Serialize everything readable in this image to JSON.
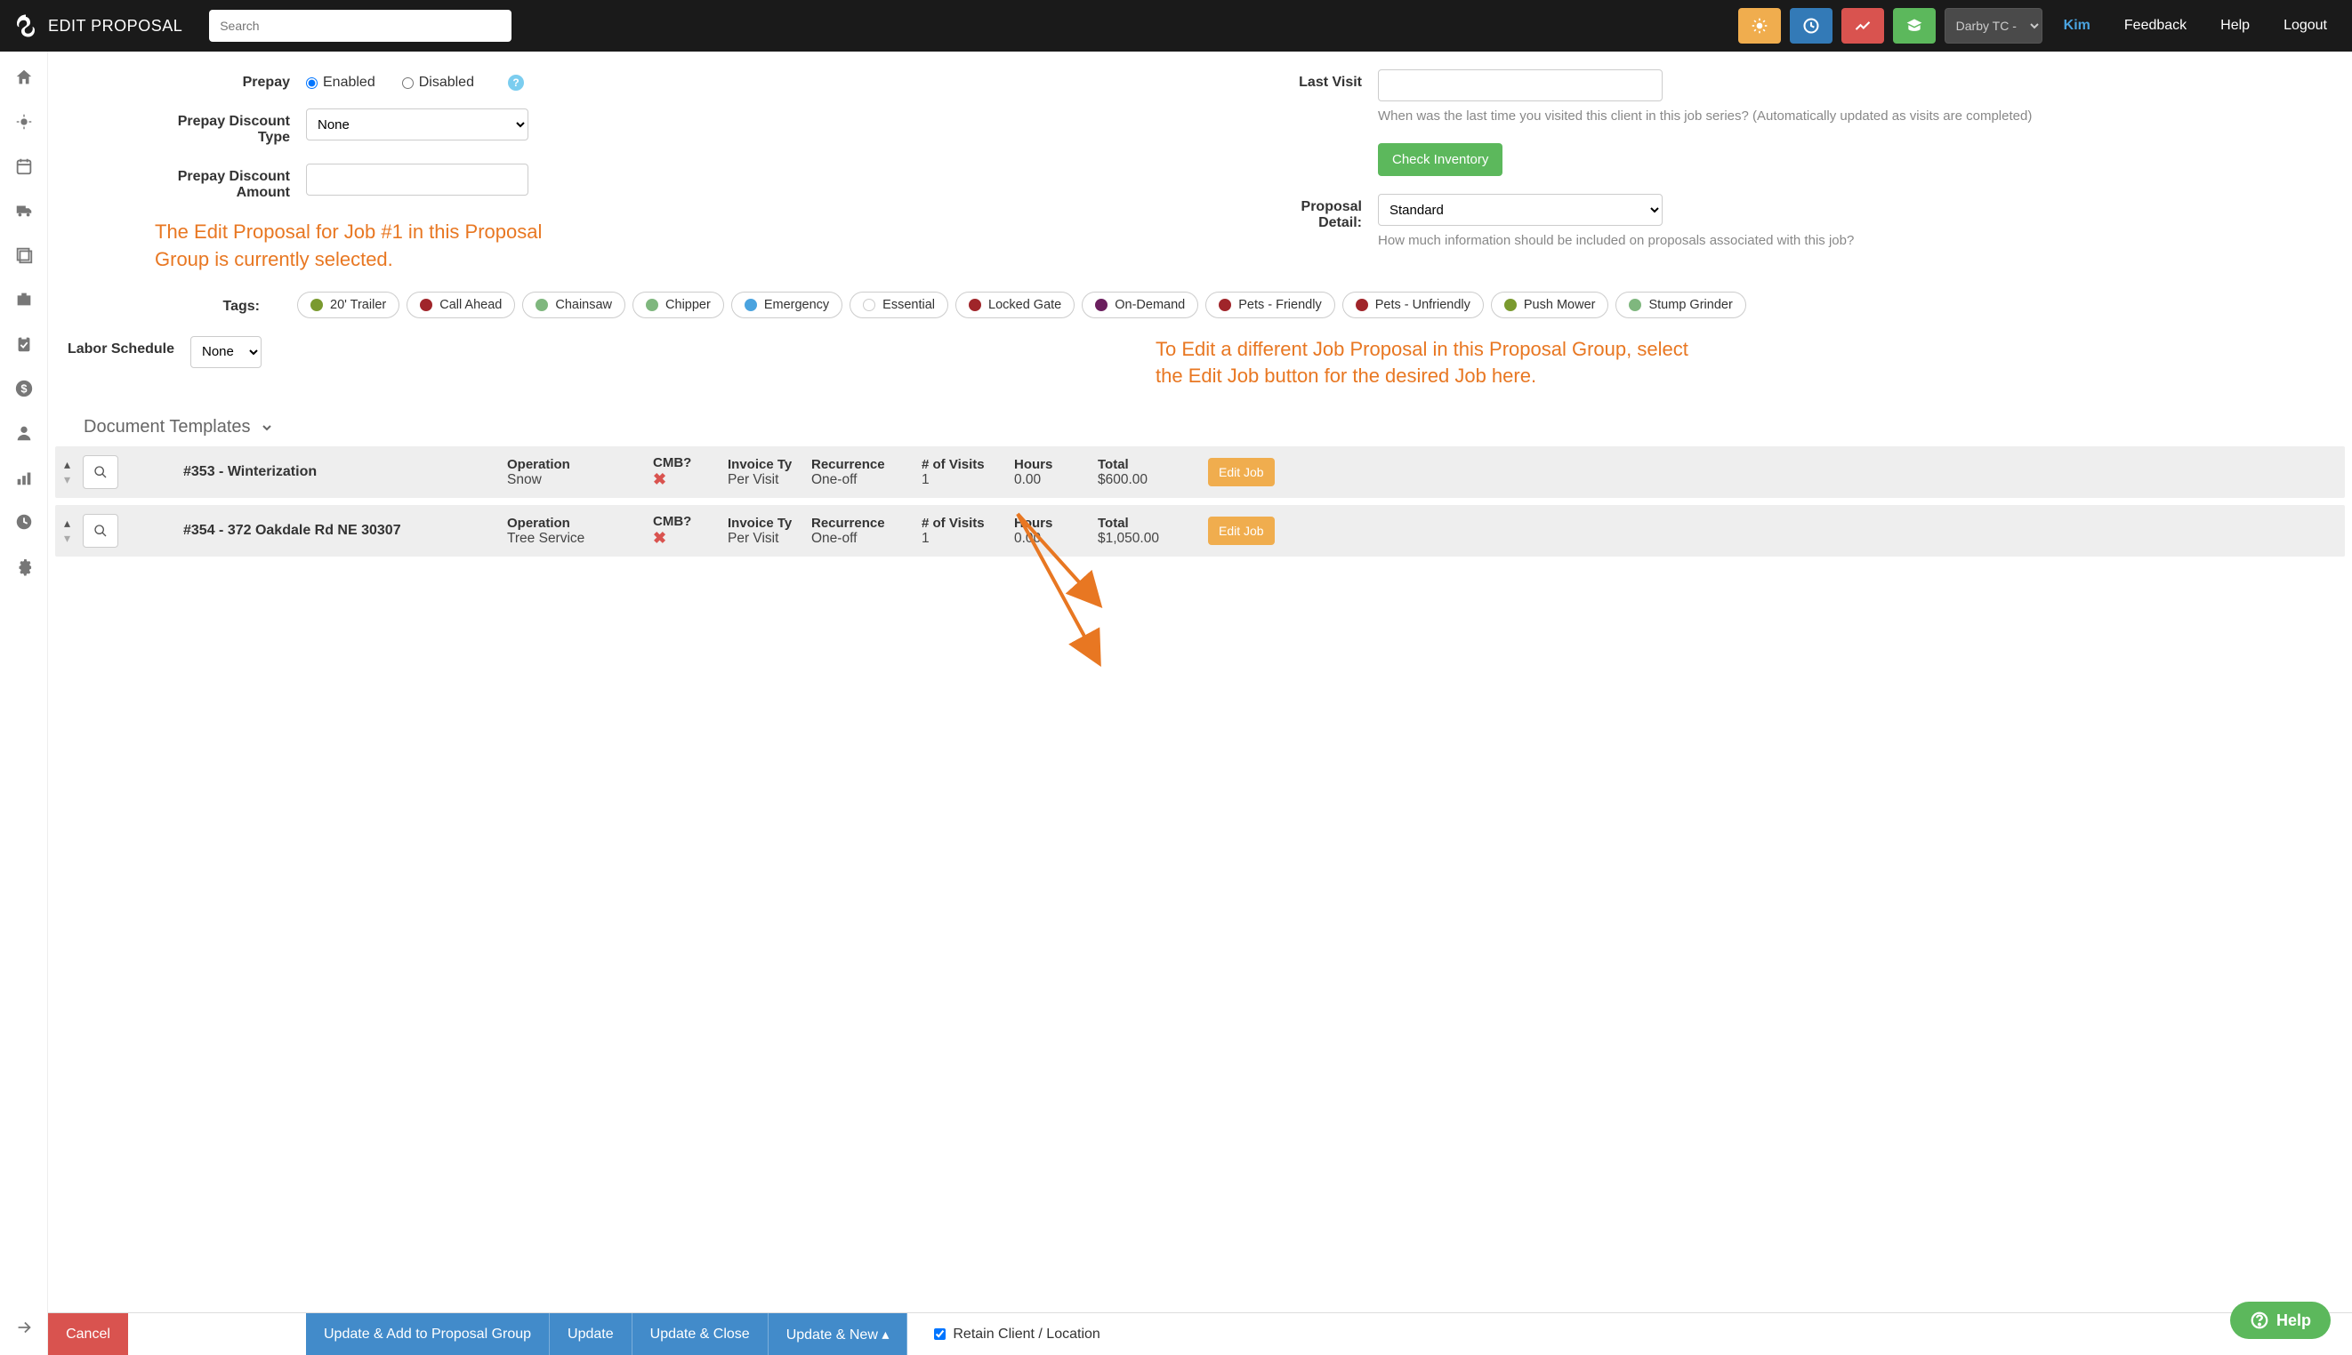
{
  "header": {
    "title": "EDIT PROPOSAL",
    "search_placeholder": "Search",
    "org_selector": "Darby TC - Ki",
    "user": "Kim",
    "links": {
      "feedback": "Feedback",
      "help": "Help",
      "logout": "Logout"
    }
  },
  "form": {
    "prepay": {
      "label": "Prepay",
      "enabled": "Enabled",
      "disabled": "Disabled",
      "selected": "enabled"
    },
    "discount_type": {
      "label": "Prepay Discount Type",
      "value": "None"
    },
    "discount_amount": {
      "label": "Prepay Discount Amount",
      "value": ""
    },
    "last_visit": {
      "label": "Last Visit",
      "value": "",
      "help": "When was the last time you visited this client in this job series? (Automatically updated as visits are completed)"
    },
    "check_inventory": "Check Inventory",
    "proposal_detail": {
      "label": "Proposal Detail:",
      "value": "Standard",
      "help": "How much information should be included on proposals associated with this job?"
    },
    "labor_schedule": {
      "label": "Labor Schedule",
      "value": "None"
    }
  },
  "callouts": {
    "left": "The Edit Proposal for Job #1 in this Proposal Group is currently selected.",
    "right": "To Edit a different Job Proposal in this Proposal Group, select the Edit Job button for the desired Job here."
  },
  "tags_label": "Tags:",
  "tags": [
    {
      "label": "20' Trailer",
      "color": "#7a9a2f"
    },
    {
      "label": "Call Ahead",
      "color": "#a0252a"
    },
    {
      "label": "Chainsaw",
      "color": "#7fb77e"
    },
    {
      "label": "Chipper",
      "color": "#7fb77e"
    },
    {
      "label": "Emergency",
      "color": "#4aa3df"
    },
    {
      "label": "Essential",
      "color": "#ffffff"
    },
    {
      "label": "Locked Gate",
      "color": "#a0252a"
    },
    {
      "label": "On-Demand",
      "color": "#6b1f5e"
    },
    {
      "label": "Pets - Friendly",
      "color": "#a0252a"
    },
    {
      "label": "Pets - Unfriendly",
      "color": "#a0252a"
    },
    {
      "label": "Push Mower",
      "color": "#7a9a2f"
    },
    {
      "label": "Stump Grinder",
      "color": "#7fb77e"
    }
  ],
  "doc_templates": "Document Templates",
  "job_headers": {
    "operation": "Operation",
    "cmb": "CMB?",
    "invoice": "Invoice Ty",
    "recurrence": "Recurrence",
    "visits": "# of Visits",
    "hours": "Hours",
    "total": "Total",
    "edit": "Edit Job"
  },
  "jobs": [
    {
      "title": "#353 - Winterization",
      "operation": "Snow",
      "invoice": "Per Visit",
      "recurrence": "One-off",
      "visits": "1",
      "hours": "0.00",
      "total": "$600.00"
    },
    {
      "title": "#354 - 372 Oakdale Rd NE 30307",
      "operation": "Tree Service",
      "invoice": "Per Visit",
      "recurrence": "One-off",
      "visits": "1",
      "hours": "0.00",
      "total": "$1,050.00"
    }
  ],
  "footer": {
    "cancel": "Cancel",
    "update_add": "Update & Add to Proposal Group",
    "update": "Update",
    "update_close": "Update & Close",
    "update_new": "Update & New",
    "retain": "Retain Client / Location"
  },
  "help_bubble": "Help"
}
